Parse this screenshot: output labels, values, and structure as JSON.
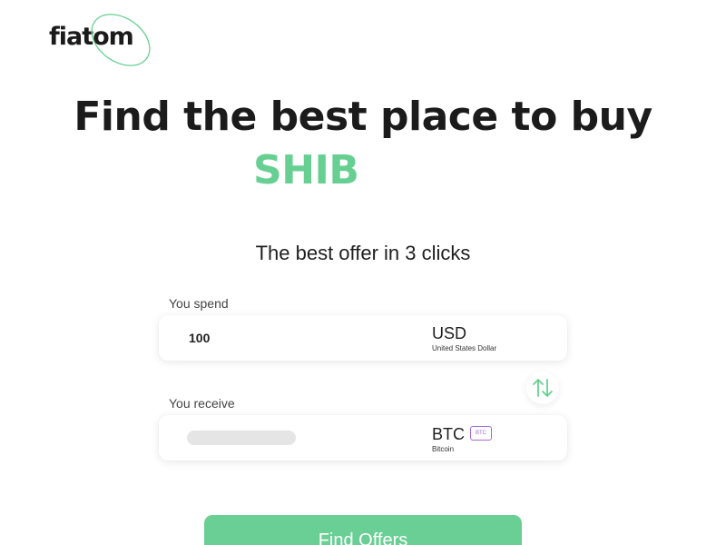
{
  "brand": {
    "name": "fiatom",
    "accent": "#67cf92"
  },
  "hero": {
    "headline": "Find the best place to buy",
    "coin": "SHIB",
    "subtitle": "The best offer in 3 clicks"
  },
  "spend": {
    "label": "You spend",
    "amount": "100",
    "currency_code": "USD",
    "currency_name": "United States Dollar"
  },
  "receive": {
    "label": "You receive",
    "amount": "",
    "currency_code": "BTC",
    "currency_name": "Bitcoin",
    "network_badge": "BTC"
  },
  "swap": {
    "icon": "swap-arrows-icon"
  },
  "cta": {
    "label": "Find Offers"
  },
  "colors": {
    "badge": "#a76ad6",
    "button": "#69cf94",
    "text": "#1b1b1b"
  }
}
